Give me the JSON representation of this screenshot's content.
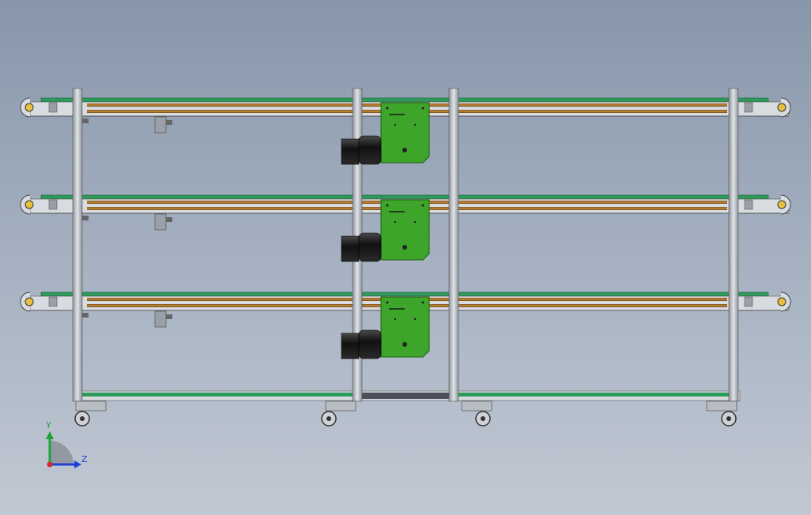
{
  "scene": {
    "description_visible": false,
    "conveyor_tiers": 3,
    "colors": {
      "background_top": "#8796aa",
      "background_bottom": "#c1c8d3",
      "belt_green": "#2e9a5b",
      "rail_orange": "#b87a2e",
      "motor_plate_green": "#3ca52a",
      "frame_silver": "#c8ccd2",
      "motor_black": "#1c1c1c"
    }
  },
  "triad": {
    "y_label": "Y",
    "z_label": "Z",
    "y_color": "#1fa23a",
    "z_color": "#1f3fd6",
    "origin_color": "#d42a2a"
  }
}
